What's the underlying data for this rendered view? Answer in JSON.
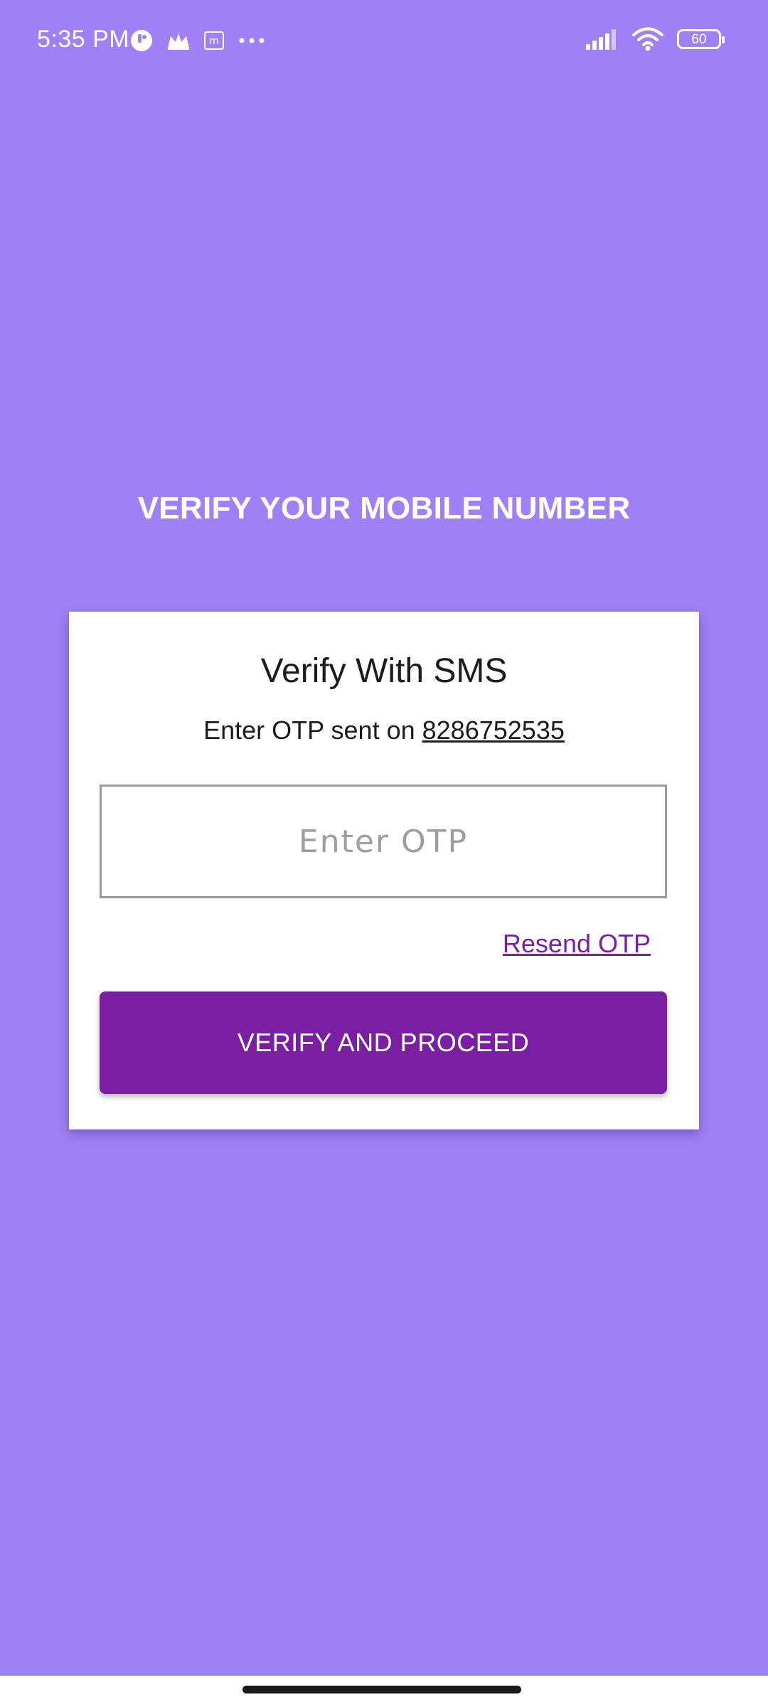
{
  "status_bar": {
    "time": "5:35 PM",
    "battery_level": "60",
    "left_icons": [
      "notification-app-icon",
      "crown-icon",
      "m-badge-icon",
      "more-dots-icon"
    ],
    "right_icons": [
      "signal-icon",
      "wifi-icon",
      "battery-icon"
    ]
  },
  "page": {
    "title": "VERIFY YOUR MOBILE NUMBER"
  },
  "card": {
    "title": "Verify With SMS",
    "subtitle_prefix": "Enter OTP sent on",
    "phone_number": "8286752535",
    "otp_input": {
      "placeholder": "Enter OTP",
      "value": ""
    },
    "resend_label": "Resend OTP",
    "verify_button_label": "VERIFY AND PROCEED"
  },
  "colors": {
    "background": "#9f80f5",
    "card": "#ffffff",
    "accent": "#7b1fa2",
    "title_text": "#ffffff"
  }
}
